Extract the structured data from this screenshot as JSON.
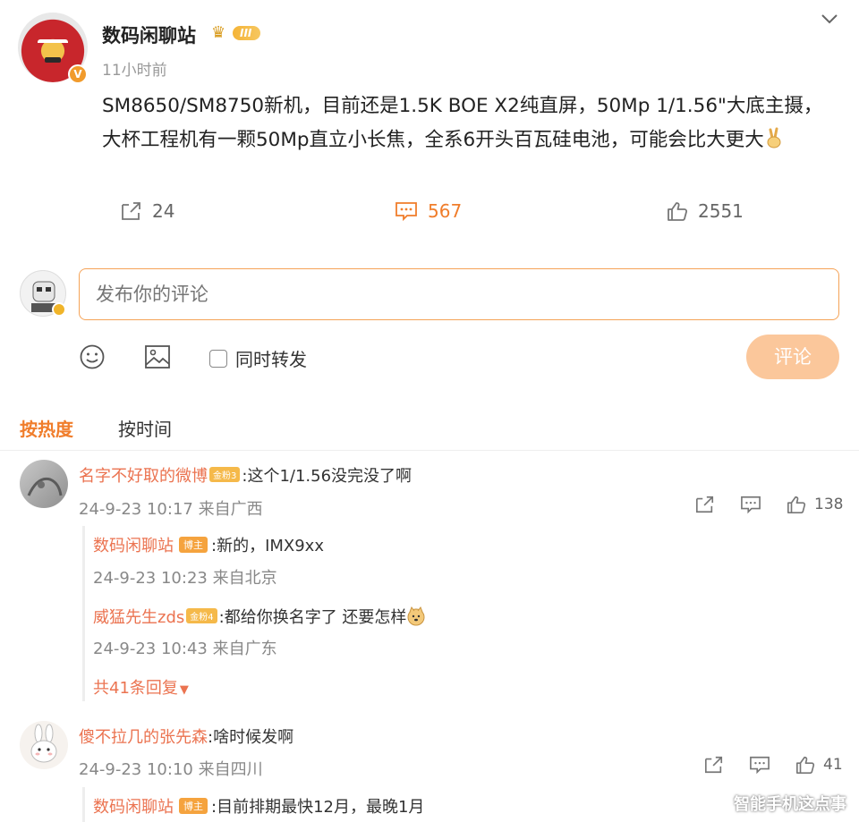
{
  "post": {
    "author": "数码闲聊站",
    "level_badge": "III",
    "time": "11小时前",
    "body": "SM8650/SM8750新机，目前还是1.5K BOE X2纯直屏，50Mp 1/1.56\"大底主摄，大杯工程机有一颗50Mp直立小长焦，全系6开头百瓦硅电池，可能会比大更大",
    "shares": "24",
    "comments": "567",
    "likes": "2551"
  },
  "composer": {
    "placeholder": "发布你的评论",
    "repost_label": "同时转发",
    "submit_label": "评论"
  },
  "sort": {
    "hot_label": "按热度",
    "time_label": "按时间"
  },
  "comments": [
    {
      "name": "名字不好取的微博",
      "fan_badge": "金粉3",
      "text": ":这个1/1.56没完没了啊",
      "meta": "24-9-23 10:17 来自广西",
      "likes": "138",
      "replies": [
        {
          "name": "数码闲聊站",
          "host_badge": "博主",
          "text": ":新的，IMX9xx",
          "meta": "24-9-23 10:23 来自北京"
        },
        {
          "name": "威猛先生zds",
          "fan_badge": "金粉4",
          "text": ":都给你换名字了 还要怎样",
          "meta": "24-9-23 10:43 来自广东"
        }
      ],
      "more_replies": "共41条回复"
    },
    {
      "name": "傻不拉几的张先森",
      "text": ":啥时候发啊",
      "meta": "24-9-23 10:10 来自四川",
      "likes": "41",
      "replies": [
        {
          "name": "数码闲聊站",
          "host_badge": "博主",
          "text": ":目前排期最快12月，最晚1月"
        }
      ]
    }
  ],
  "watermark": "智能手机这点事",
  "colors": {
    "accent": "#f07d2b",
    "name_color": "#eb7350",
    "submit_disabled": "#fbc79b"
  }
}
